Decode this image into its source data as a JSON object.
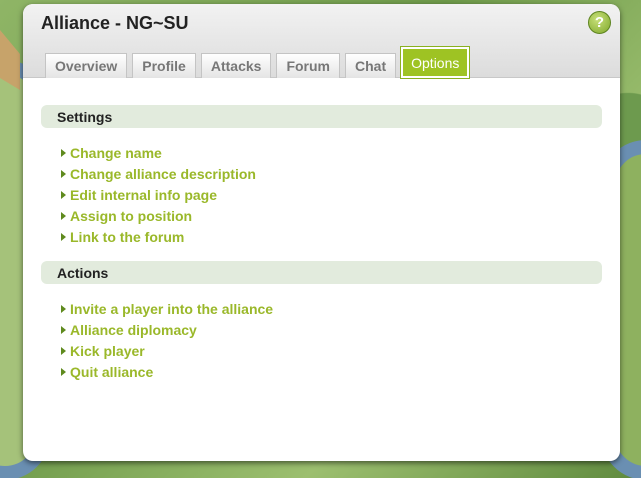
{
  "window": {
    "title": "Alliance - NG~SU",
    "help_label": "?"
  },
  "tabs": [
    {
      "label": "Overview",
      "active": false
    },
    {
      "label": "Profile",
      "active": false
    },
    {
      "label": "Attacks",
      "active": false
    },
    {
      "label": "Forum",
      "active": false
    },
    {
      "label": "Chat",
      "active": false
    },
    {
      "label": "Options",
      "active": true
    }
  ],
  "sections": {
    "settings": {
      "title": "Settings",
      "items": [
        {
          "label": "Change name"
        },
        {
          "label": "Change alliance description"
        },
        {
          "label": "Edit internal info page"
        },
        {
          "label": "Assign to position"
        },
        {
          "label": "Link to the forum"
        }
      ]
    },
    "actions": {
      "title": "Actions",
      "items": [
        {
          "label": "Invite a player into the alliance"
        },
        {
          "label": "Alliance diplomacy"
        },
        {
          "label": "Kick player"
        },
        {
          "label": "Quit alliance"
        }
      ]
    }
  },
  "colors": {
    "accent": "#9ec323",
    "link": "#9ab82a",
    "section_bar": "#e2ebdd"
  },
  "icons": {
    "help": "help-icon",
    "link_bullet": "arrow-right-icon"
  }
}
